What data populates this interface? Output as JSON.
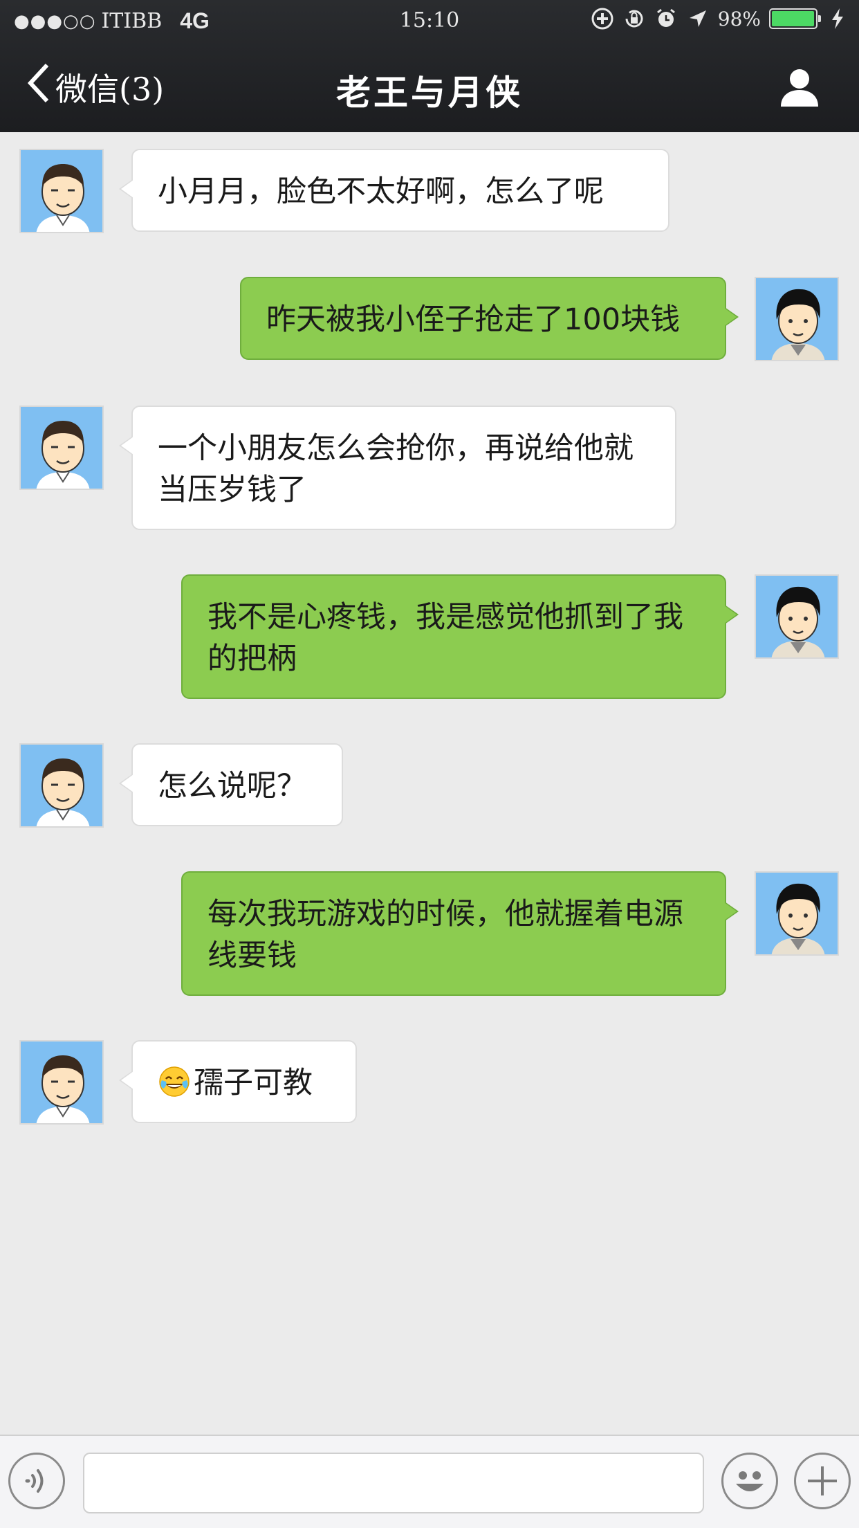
{
  "status_bar": {
    "signal": "●●●○○",
    "carrier": "ITIBB",
    "network": "4G",
    "time": "15:10",
    "battery_percent": "98%",
    "battery_level": 0.98
  },
  "nav": {
    "back_label": "微信(3)",
    "title": "老王与月侠"
  },
  "messages": [
    {
      "side": "left",
      "text": "小月月，脸色不太好啊，怎么了呢"
    },
    {
      "side": "right",
      "text": "昨天被我小侄子抢走了100块钱"
    },
    {
      "side": "left",
      "text": "一个小朋友怎么会抢你，再说给他就当压岁钱了"
    },
    {
      "side": "right",
      "text": "我不是心疼钱，我是感觉他抓到了我的把柄"
    },
    {
      "side": "left",
      "text": "怎么说呢？"
    },
    {
      "side": "right",
      "text": "每次我玩游戏的时候，他就握着电源线要钱"
    },
    {
      "side": "left",
      "emoji": "face-with-tears-of-joy",
      "text": "孺子可教"
    }
  ],
  "input_bar": {
    "value": "",
    "placeholder": ""
  },
  "colors": {
    "nav_bg": "#1f2023",
    "chat_bg": "#ebebeb",
    "sent_bubble": "#8ccc50",
    "received_bubble": "#ffffff",
    "avatar_bg": "#7fbff2",
    "battery": "#4cd964"
  }
}
